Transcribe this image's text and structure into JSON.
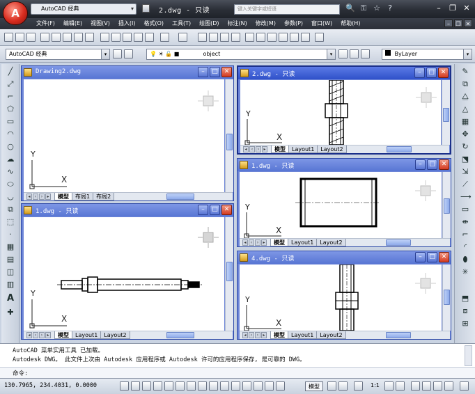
{
  "titlebar": {
    "workspace": "AutoCAD 经典",
    "document_title": "2.dwg - 只读",
    "search_placeholder": "键入关键字或短语"
  },
  "menu": [
    "文件(F)",
    "编辑(E)",
    "视图(V)",
    "插入(I)",
    "格式(O)",
    "工具(T)",
    "绘图(D)",
    "标注(N)",
    "修改(M)",
    "参数(P)",
    "窗口(W)",
    "帮助(H)"
  ],
  "toolbar2": {
    "workspace_combo": "AutoCAD 经典",
    "layer_combo": "object",
    "color_combo": "ByLayer"
  },
  "windows": [
    {
      "title": "Drawing2.dwg",
      "tabs": [
        "模型",
        "布局1",
        "布局2"
      ]
    },
    {
      "title": "1.dwg - 只读",
      "tabs": [
        "模型",
        "Layout1",
        "Layout2"
      ]
    },
    {
      "title": "2.dwg - 只读",
      "tabs": [
        "模型",
        "Layout1",
        "Layout2"
      ]
    },
    {
      "title": "1.dwg - 只读",
      "tabs": [
        "模型",
        "Layout1",
        "Layout2"
      ]
    },
    {
      "title": "4.dwg - 只读",
      "tabs": [
        "模型",
        "Layout1",
        "Layout2"
      ]
    }
  ],
  "ucs": {
    "x_label": "X",
    "y_label": "Y"
  },
  "command": {
    "line1": "AutoCAD 菜单实用工具 已加载。",
    "line2": "Autodesk DWG。 此文件上次由 Autodesk 应用程序或 Autodesk 许可的应用程序保存, 是可靠的 DWG。",
    "prompt": "命令:"
  },
  "status": {
    "coordinates": "130.7965, 234.4031, 0.0000",
    "model_label": "模型",
    "scale": "1:1"
  },
  "colors": {
    "title_bar": "#2a2e36",
    "mdi_frame": "#6e86d8",
    "close_button": "#d33a1f",
    "canvas": "#ffffff"
  }
}
